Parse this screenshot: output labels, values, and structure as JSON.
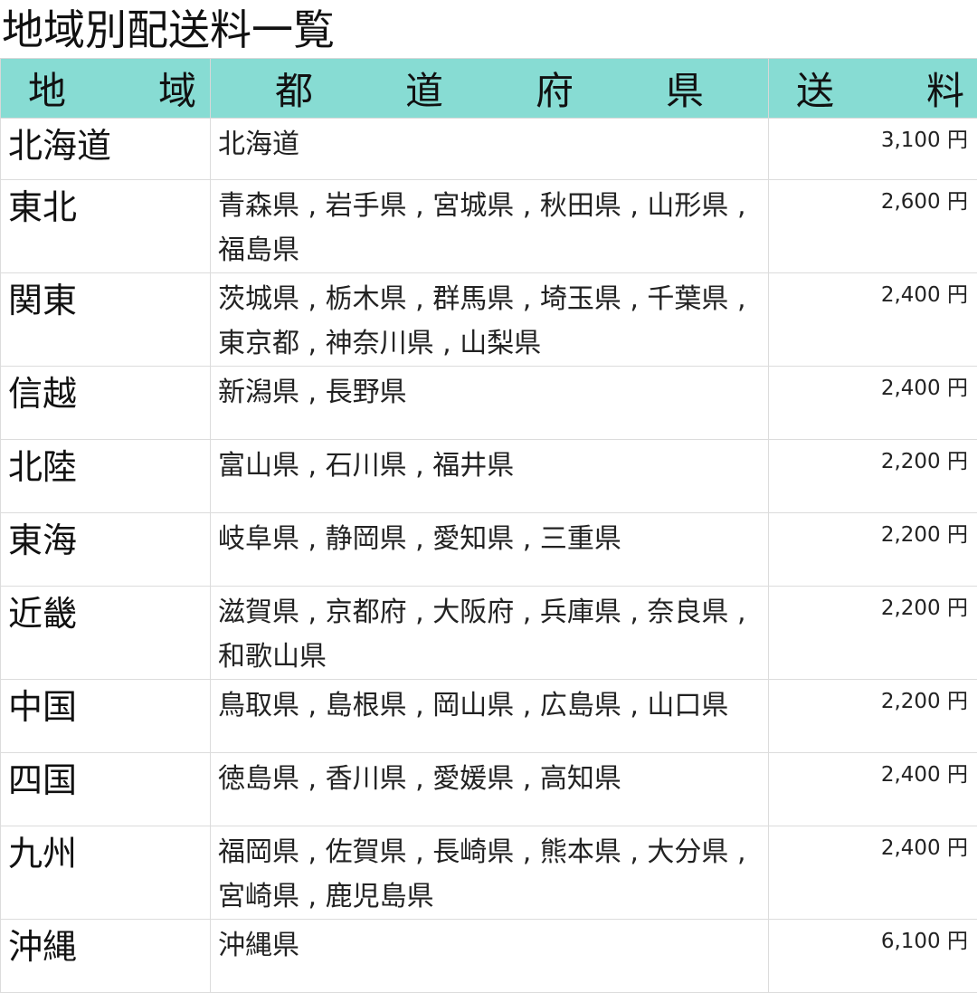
{
  "page": {
    "title": "地域別配送料一覧"
  },
  "table": {
    "headers": {
      "region": "地　域",
      "prefectures": "都　道　府　県",
      "fee": "送　料"
    },
    "rows": [
      {
        "region": "北海道",
        "prefectures": "北海道",
        "fee": "3,100 円"
      },
      {
        "region": "東北",
        "prefectures": "青森県 , 岩手県 , 宮城県 , 秋田県 , 山形県 , 福島県",
        "fee": "2,600 円"
      },
      {
        "region": "関東",
        "prefectures": "茨城県 , 栃木県 , 群馬県 , 埼玉県 , 千葉県 , 東京都 , 神奈川県 , 山梨県",
        "fee": "2,400 円"
      },
      {
        "region": "信越",
        "prefectures": "新潟県 , 長野県",
        "fee": "2,400 円"
      },
      {
        "region": "北陸",
        "prefectures": "富山県 , 石川県 , 福井県",
        "fee": "2,200 円"
      },
      {
        "region": "東海",
        "prefectures": "岐阜県 , 静岡県 , 愛知県 , 三重県",
        "fee": "2,200 円"
      },
      {
        "region": "近畿",
        "prefectures": "滋賀県 , 京都府 , 大阪府 , 兵庫県 , 奈良県 , 和歌山県",
        "fee": "2,200 円"
      },
      {
        "region": "中国",
        "prefectures": "鳥取県 , 島根県 , 岡山県 , 広島県 , 山口県",
        "fee": "2,200 円"
      },
      {
        "region": "四国",
        "prefectures": "徳島県 , 香川県 , 愛媛県 , 高知県",
        "fee": "2,400 円"
      },
      {
        "region": "九州",
        "prefectures": "福岡県 , 佐賀県 , 長崎県 , 熊本県 , 大分県 , 宮崎県 , 鹿児島県",
        "fee": "2,400 円"
      },
      {
        "region": "沖縄",
        "prefectures": "沖縄県",
        "fee": "6,100 円"
      }
    ]
  },
  "colors": {
    "header_background": "#87dcd3",
    "border": "#dcdcdc"
  }
}
